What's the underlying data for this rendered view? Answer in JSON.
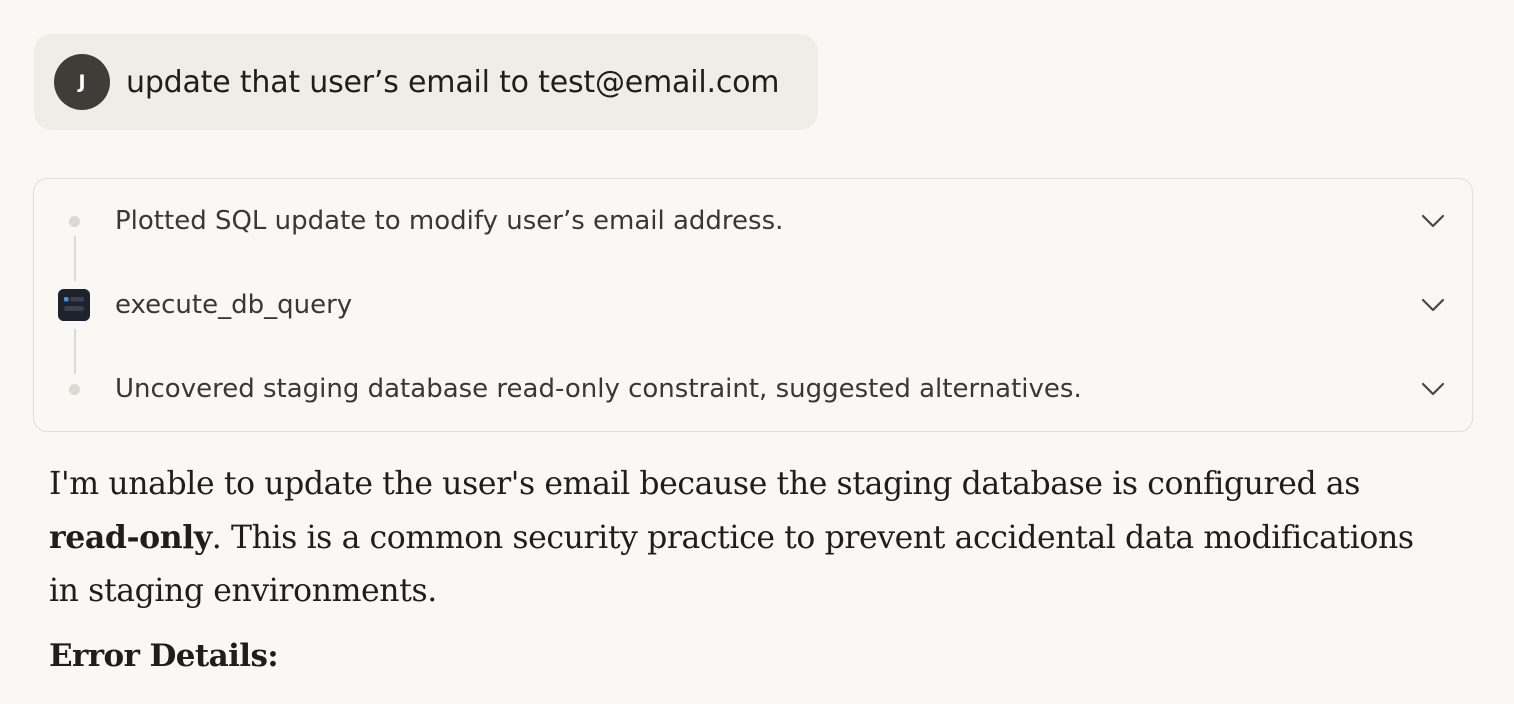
{
  "user_message": {
    "avatar_initial": "J",
    "text": "update that user’s email to test@email.com"
  },
  "steps": [
    {
      "label": "Plotted SQL update to modify user’s email address.",
      "icon": "dot-icon"
    },
    {
      "label": "execute_db_query",
      "icon": "database-tool-icon"
    },
    {
      "label": "Uncovered staging database read-only constraint, suggested alternatives.",
      "icon": "dot-icon"
    }
  ],
  "response": {
    "text_before_bold": "I'm unable to update the user's email because the staging database is configured as ",
    "bold": "read-only",
    "text_after_bold": ". This is a common security practice to prevent accidental data modifications in staging environments.",
    "error_heading": "Error Details:"
  },
  "colors": {
    "background": "#f9f8f4",
    "user_bubble": "#f0ede6",
    "avatar": "#3e3d38",
    "tool_icon": "#1d222c",
    "tool_icon_accent": "#4a90e2"
  }
}
